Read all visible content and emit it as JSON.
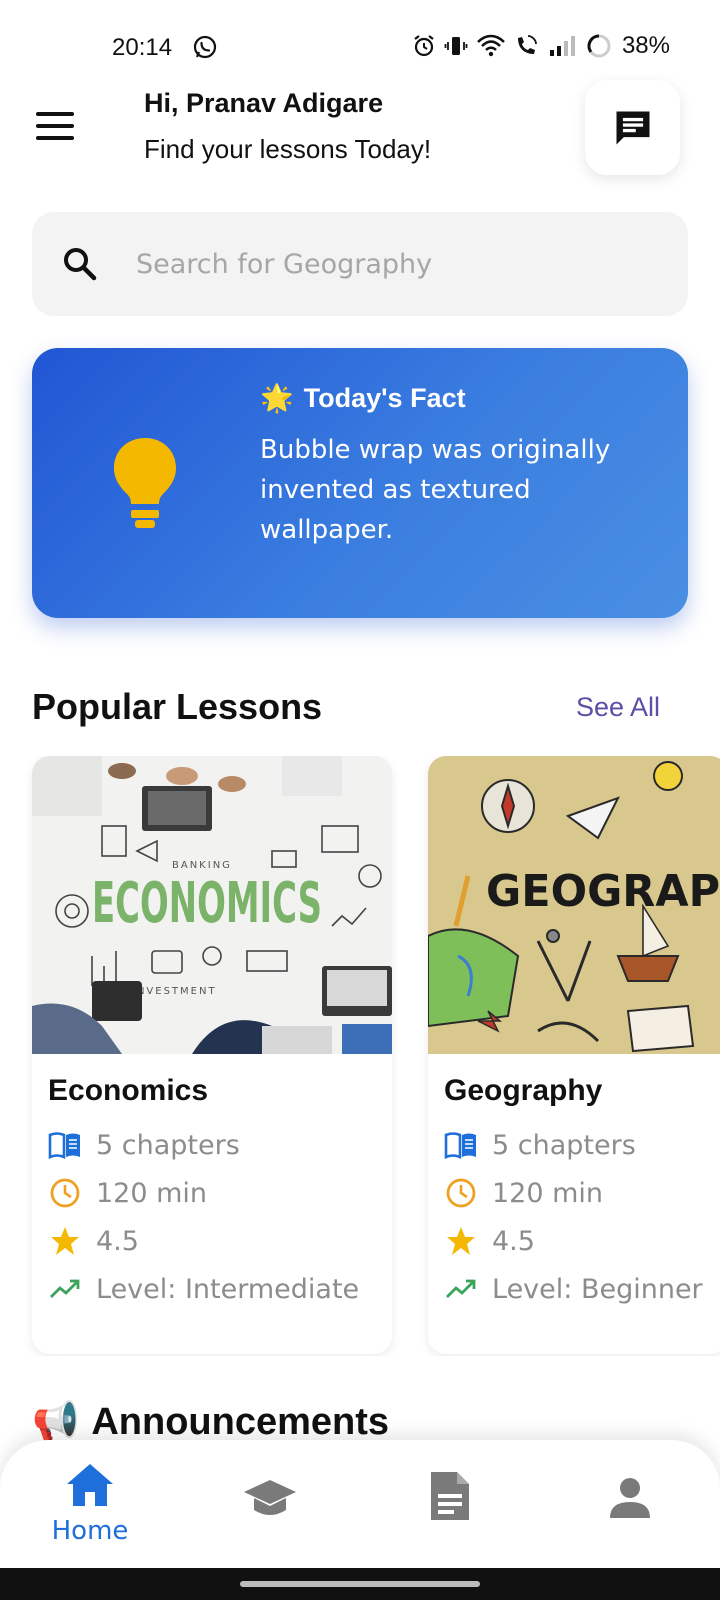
{
  "status_bar": {
    "time": "20:14",
    "battery": "38%"
  },
  "header": {
    "greeting": "Hi, Pranav Adigare",
    "subtitle": "Find your lessons Today!"
  },
  "search": {
    "placeholder": "Search for Geography"
  },
  "fact": {
    "emoji": "🌟",
    "title": "Today's Fact",
    "text": "Bubble wrap was originally invented as textured wallpaper."
  },
  "popular": {
    "title": "Popular Lessons",
    "see_all": "See All",
    "lessons": [
      {
        "image_label": "ECONOMICS",
        "name": "Economics",
        "chapters": "5 chapters",
        "duration": "120 min",
        "rating": "4.5",
        "level": "Level: Intermediate"
      },
      {
        "image_label": "GEOGRAPH",
        "name": "Geography",
        "chapters": "5 chapters",
        "duration": "120 min",
        "rating": "4.5",
        "level": "Level: Beginner"
      }
    ]
  },
  "announcements": {
    "emoji": "📢",
    "title": "Announcements"
  },
  "nav": {
    "home": "Home"
  },
  "colors": {
    "accent": "#1e6fd9",
    "fact_gradient_start": "#2156d4",
    "fact_gradient_end": "#4a8fe2",
    "bulb": "#f5b800",
    "see_all": "#5b4fa8"
  }
}
